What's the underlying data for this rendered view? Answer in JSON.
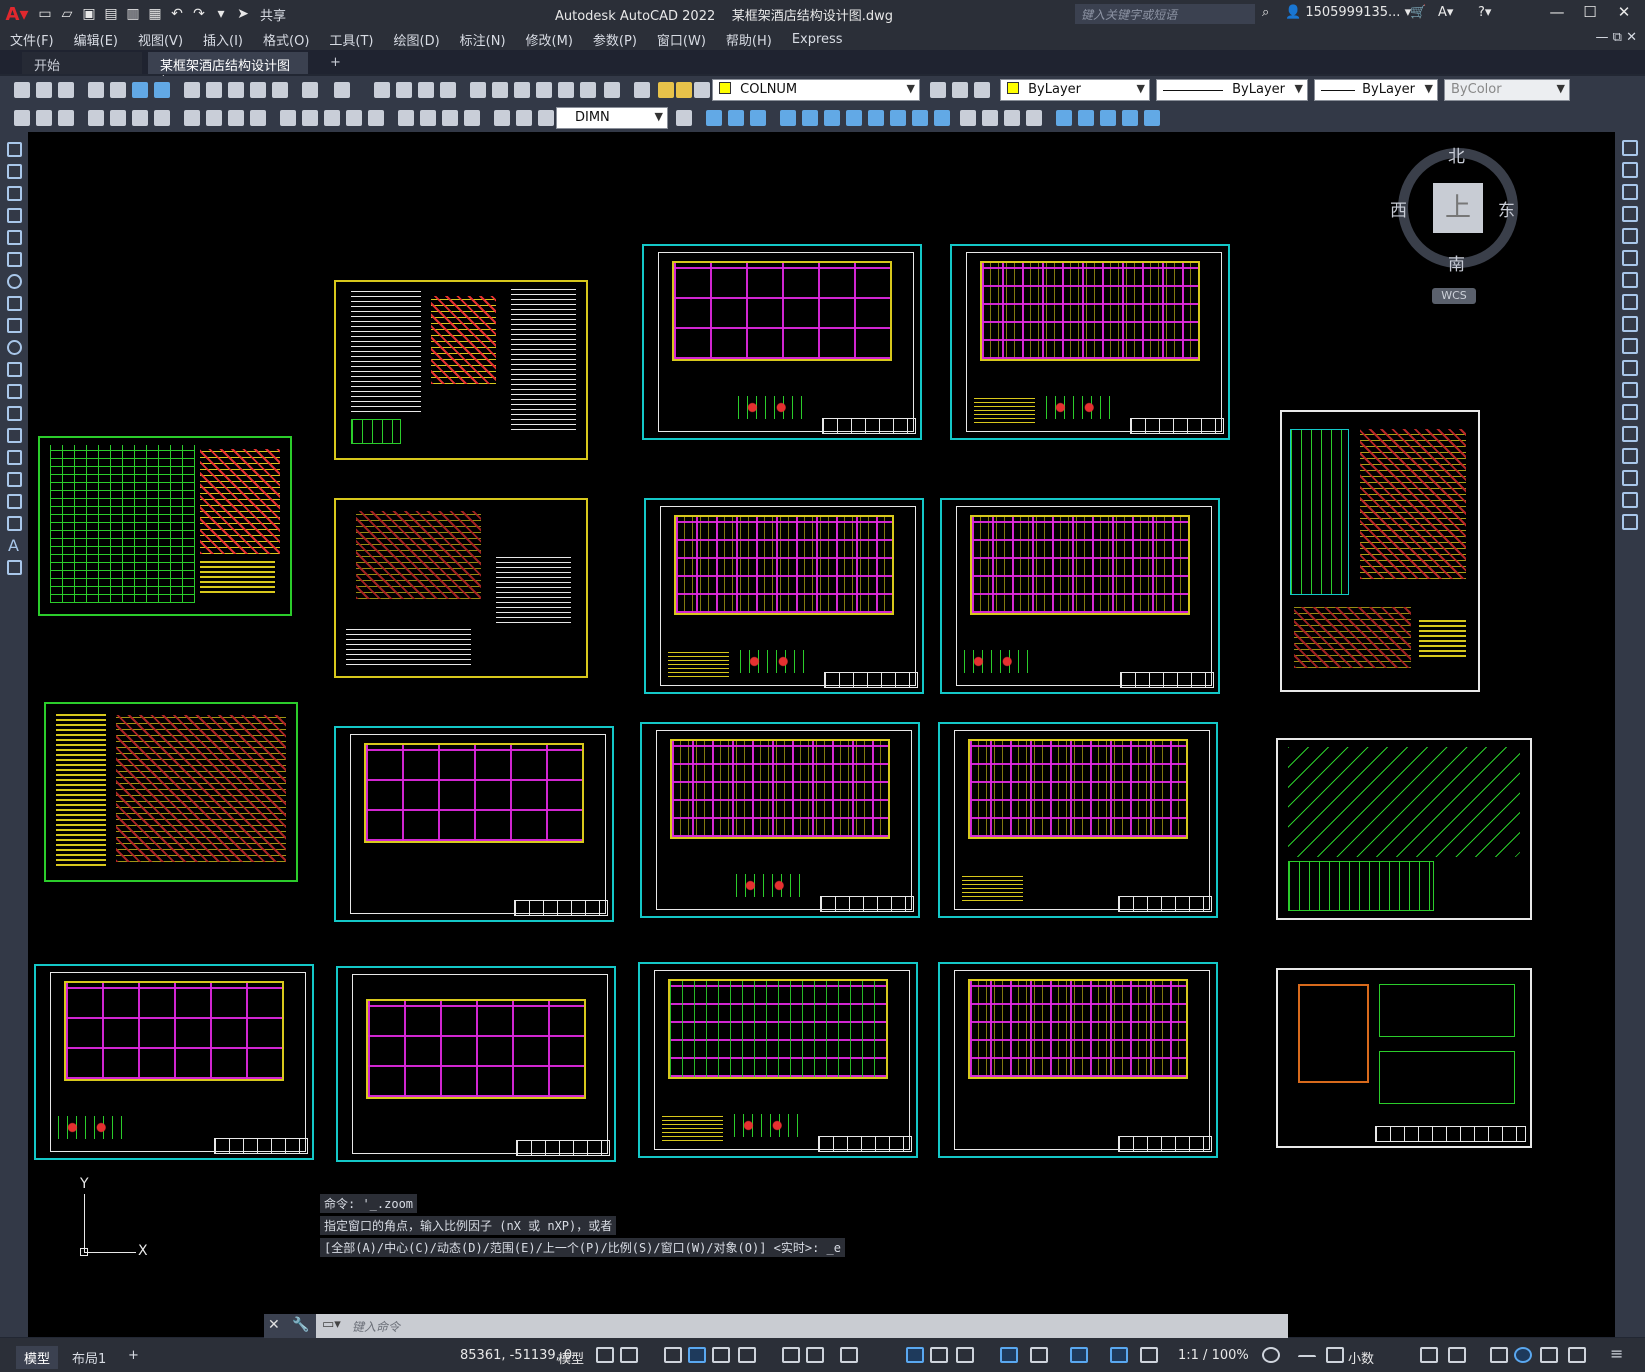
{
  "app": {
    "window_title": "Autodesk AutoCAD 2022",
    "file_name": "某框架酒店结构设计图.dwg",
    "share_label": "共享",
    "search_placeholder": "键入关键字或短语",
    "account": "1505999135..."
  },
  "menu": [
    "文件(F)",
    "编辑(E)",
    "视图(V)",
    "插入(I)",
    "格式(O)",
    "工具(T)",
    "绘图(D)",
    "标注(N)",
    "修改(M)",
    "参数(P)",
    "窗口(W)",
    "帮助(H)",
    "Express"
  ],
  "tabs": {
    "start": "开始",
    "drawing": "某框架酒店结构设计图*",
    "add": "+"
  },
  "properties": {
    "layer": "COLNUM",
    "layer_color": "#ffff00",
    "color": "ByLayer",
    "linetype": "ByLayer",
    "lineweight": "ByLayer",
    "plotstyle": "ByColor",
    "dimstyle": "DIMN"
  },
  "viewcube": {
    "top_face": "上",
    "north": "北",
    "south": "南",
    "east": "东",
    "west": "西",
    "wcs": "WCS"
  },
  "ucs": {
    "x": "X",
    "y": "Y"
  },
  "command": {
    "history": [
      "命令: '_.zoom",
      "指定窗口的角点，输入比例因子 (nX 或 nXP)，或者",
      "[全部(A)/中心(C)/动态(D)/范围(E)/上一个(P)/比例(S)/窗口(W)/对象(O)] <实时>: _e"
    ],
    "placeholder": "键入命令"
  },
  "status": {
    "model_tab": "模型",
    "layout_tab": "布局1",
    "add_tab": "+",
    "coordinates": "85361, -51139, 0",
    "space": "模型",
    "annotation_scale": "1:1 / 100%",
    "units": "小数"
  },
  "colors": {
    "canvas": "#000000",
    "sheet_frame": "#14c8c8",
    "structure_yellow": "#d8c81c",
    "beam_magenta": "#dc28dc",
    "table_green": "#2bcc2b"
  }
}
